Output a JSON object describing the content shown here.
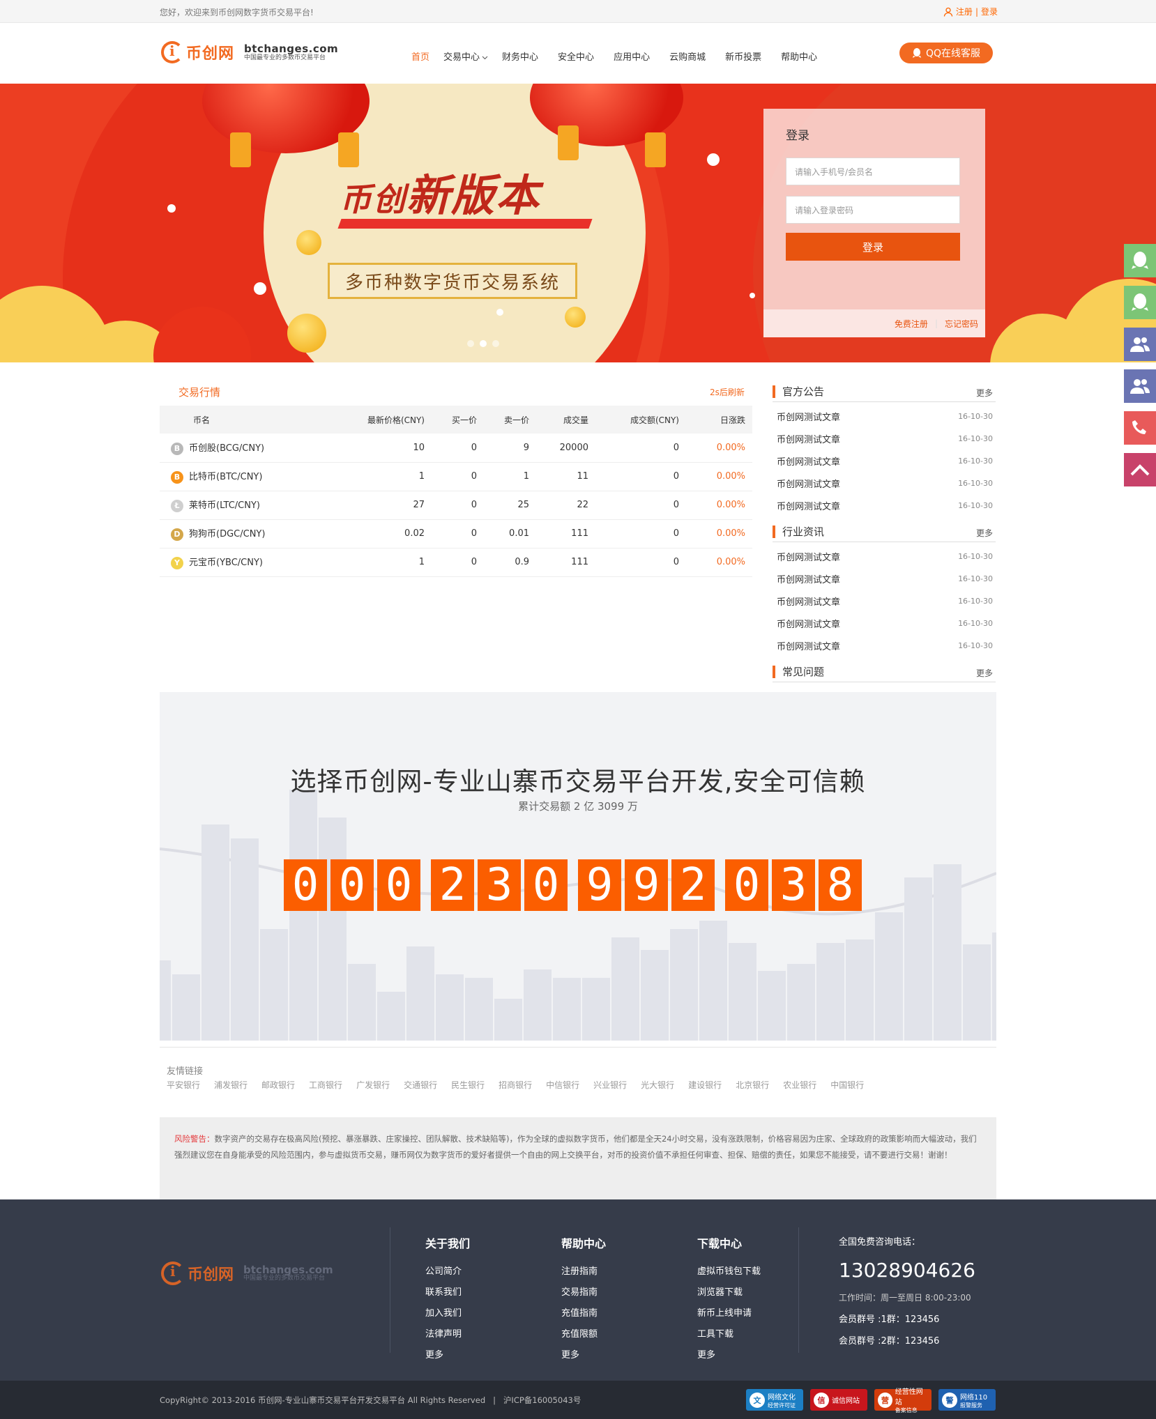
{
  "topbar": {
    "welcome": "您好，欢迎来到币创网数字货币交易平台!",
    "register": "注册",
    "sep": "|",
    "login": "登录"
  },
  "logo": {
    "cn": "币创网",
    "domain": "btchanges.com",
    "tagline": "中国最专业的多数币交易平台"
  },
  "nav": {
    "items": [
      "首页",
      "交易中心",
      "财务中心",
      "安全中心",
      "应用中心",
      "云购商城",
      "新币投票",
      "帮助中心"
    ],
    "active": 0
  },
  "qq_service": "QQ在线客服",
  "banner": {
    "title_a": "币创",
    "title_b": "新版本",
    "subtitle": "多币种数字货币交易系统"
  },
  "login": {
    "title": "登录",
    "user_placeholder": "请输入手机号/会员名",
    "pass_placeholder": "请输入登录密码",
    "submit": "登录",
    "free_register": "免费注册",
    "forgot": "忘记密码"
  },
  "market": {
    "title": "交易行情",
    "refresh": "2s后刷新",
    "headers": [
      "币名",
      "最新价格(CNY)",
      "买一价",
      "卖一价",
      "成交量",
      "成交额(CNY)",
      "日涨跌"
    ],
    "rows": [
      {
        "name": "币创股(BCG/CNY)",
        "icon": "bcg-coin-icon",
        "price": "10",
        "buy": "0",
        "sell": "9",
        "volume": "20000",
        "amount": "0",
        "change": "0.00%"
      },
      {
        "name": "比特币(BTC/CNY)",
        "icon": "btc-coin-icon",
        "price": "1",
        "buy": "0",
        "sell": "1",
        "volume": "11",
        "amount": "0",
        "change": "0.00%"
      },
      {
        "name": "莱特币(LTC/CNY)",
        "icon": "ltc-coin-icon",
        "price": "27",
        "buy": "0",
        "sell": "25",
        "volume": "22",
        "amount": "0",
        "change": "0.00%"
      },
      {
        "name": "狗狗币(DGC/CNY)",
        "icon": "dgc-coin-icon",
        "price": "0.02",
        "buy": "0",
        "sell": "0.01",
        "volume": "111",
        "amount": "0",
        "change": "0.00%"
      },
      {
        "name": "元宝币(YBC/CNY)",
        "icon": "ybc-coin-icon",
        "price": "1",
        "buy": "0",
        "sell": "0.9",
        "volume": "111",
        "amount": "0",
        "change": "0.00%"
      }
    ]
  },
  "news": {
    "more": "更多",
    "sections": [
      {
        "title": "官方公告",
        "items": [
          {
            "t": "币创网测试文章",
            "d": "16-10-30"
          },
          {
            "t": "币创网测试文章",
            "d": "16-10-30"
          },
          {
            "t": "币创网测试文章",
            "d": "16-10-30"
          },
          {
            "t": "币创网测试文章",
            "d": "16-10-30"
          },
          {
            "t": "币创网测试文章",
            "d": "16-10-30"
          }
        ]
      },
      {
        "title": "行业资讯",
        "items": [
          {
            "t": "币创网测试文章",
            "d": "16-10-30"
          },
          {
            "t": "币创网测试文章",
            "d": "16-10-30"
          },
          {
            "t": "币创网测试文章",
            "d": "16-10-30"
          },
          {
            "t": "币创网测试文章",
            "d": "16-10-30"
          },
          {
            "t": "币创网测试文章",
            "d": "16-10-30"
          }
        ]
      },
      {
        "title": "常见问题",
        "items": []
      }
    ]
  },
  "stats": {
    "title": "选择币创网-专业山寨币交易平台开发,安全可信赖",
    "subtitle": "累计交易额 2 亿 3099 万",
    "digit_groups": [
      "000",
      "230",
      "992",
      "038"
    ]
  },
  "friend_links": {
    "title": "友情链接",
    "items": [
      "平安银行",
      "浦发银行",
      "邮政银行",
      "工商银行",
      "广发银行",
      "交通银行",
      "民生银行",
      "招商银行",
      "中信银行",
      "兴业银行",
      "光大银行",
      "建设银行",
      "北京银行",
      "农业银行",
      "中国银行"
    ]
  },
  "warning": {
    "label": "风险警告：",
    "text": "数字资产的交易存在极高风险(预挖、暴涨暴跌、庄家操控、团队解散、技术缺陷等)，作为全球的虚拟数字货币，他们都是全天24小时交易，没有涨跌限制，价格容易因为庄家、全球政府的政策影响而大幅波动，我们强烈建议您在自身能承受的风险范围内，参与虚拟货币交易，赚币网仅为数字货币的爱好者提供一个自由的网上交换平台，对币的投资价值不承担任何审查、担保、赔偿的责任，如果您不能接受，请不要进行交易！谢谢！"
  },
  "footer": {
    "columns": [
      {
        "title": "关于我们",
        "items": [
          "公司简介",
          "联系我们",
          "加入我们",
          "法律声明",
          "更多"
        ]
      },
      {
        "title": "帮助中心",
        "items": [
          "注册指南",
          "交易指南",
          "充值指南",
          "充值限额",
          "更多"
        ]
      },
      {
        "title": "下载中心",
        "items": [
          "虚拟币钱包下载",
          "浏览器下载",
          "新币上线申请",
          "工具下载",
          "更多"
        ]
      }
    ],
    "contact_label": "全国免费咨询电话：",
    "phone": "13028904626",
    "hours": "工作时间：周一至周日 8:00-23:00",
    "group1": "会员群号 :1群：123456",
    "group2": "会员群号 :2群：123456"
  },
  "bottom": {
    "copyright": "CopyRight© 2013-2016 币创网-专业山寨币交易平台开发交易平台 All Rights Reserved",
    "sep": "|",
    "icp": "沪ICP备16005043号",
    "badges": [
      {
        "label": "网络文化",
        "sub": "经营许可证",
        "color": "#1c7fc4"
      },
      {
        "label": "诚信网站",
        "sub": "",
        "color": "#c8161d"
      },
      {
        "label": "经营性网站",
        "sub": "备案信息",
        "color": "#d33c0c"
      },
      {
        "label": "网络110",
        "sub": "报警服务",
        "color": "#1f61b0"
      }
    ]
  },
  "float_colors": [
    "#7cc576",
    "#7cc576",
    "#6a74b3",
    "#6a74b3",
    "#e85a5a",
    "#c8426a"
  ]
}
